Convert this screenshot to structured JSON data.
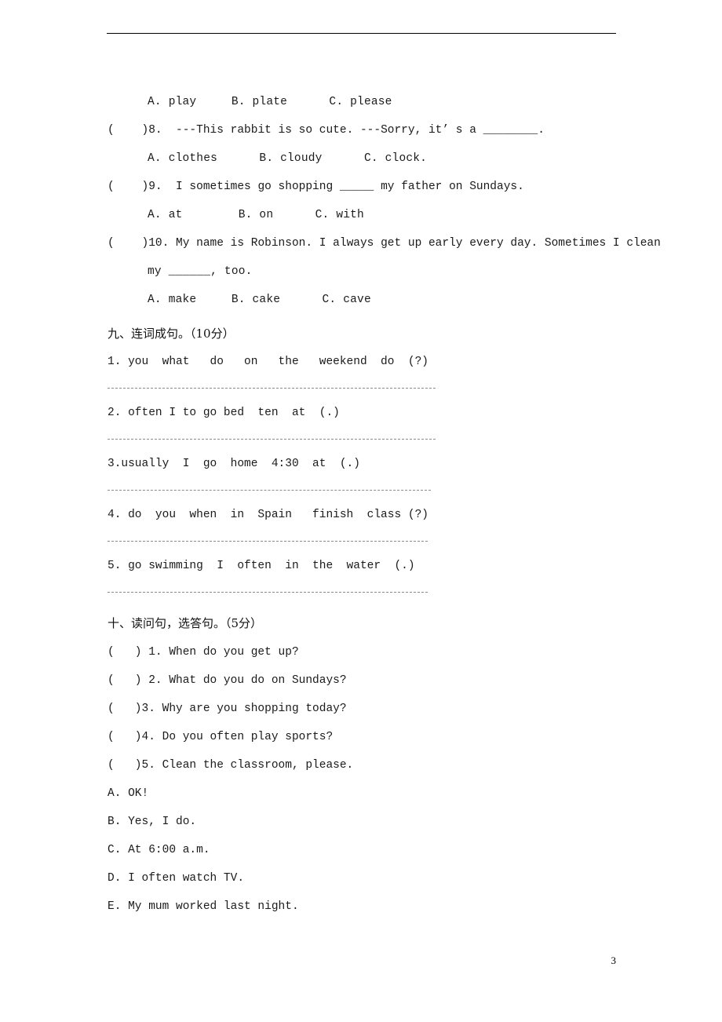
{
  "page": {
    "page_number": "3"
  },
  "multiple_choice_tail": {
    "q7_options": "A. play     B. plate      C. please",
    "items": [
      {
        "marker": "(    )8.",
        "stem": "---This rabbit is so cute. ---Sorry, it’ s a ________.",
        "options": "A. clothes      B. cloudy      C. clock."
      },
      {
        "marker": "(    )9.",
        "stem": "I sometimes go shopping _____ my father on Sundays.",
        "options": "A. at        B. on      C. with"
      },
      {
        "marker": "(    )10.",
        "stem_line1": "My name is Robinson. I always get up early every day. Sometimes I clean",
        "stem_line2": "my ______, too.",
        "options": "A. make     B. cake      C. cave"
      }
    ]
  },
  "section_nine": {
    "heading": "九、连词成句。（10分）",
    "items": [
      "1. you  what   do   on   the   weekend  do  (?)",
      "2. often I to go bed  ten  at  (.)",
      "3.usually  I  go  home  4:30  at  (.)",
      "4. do  you  when  in  Spain   finish  class (?)",
      "5. go swimming  I  often  in  the  water  (.)"
    ]
  },
  "section_ten": {
    "heading": "十、读问句，选答句。（5分）",
    "questions": [
      "(   ) 1. When do you get up?",
      "(   ) 2. What do you do on Sundays?",
      "(   )3. Why are you shopping today?",
      "(   )4. Do you often play sports?",
      "(   )5. Clean the classroom, please."
    ],
    "answers": [
      "A. OK!",
      "B. Yes, I do.",
      "C. At 6:00 a.m.",
      "D. I often watch TV.",
      "E. My mum worked last night."
    ]
  }
}
